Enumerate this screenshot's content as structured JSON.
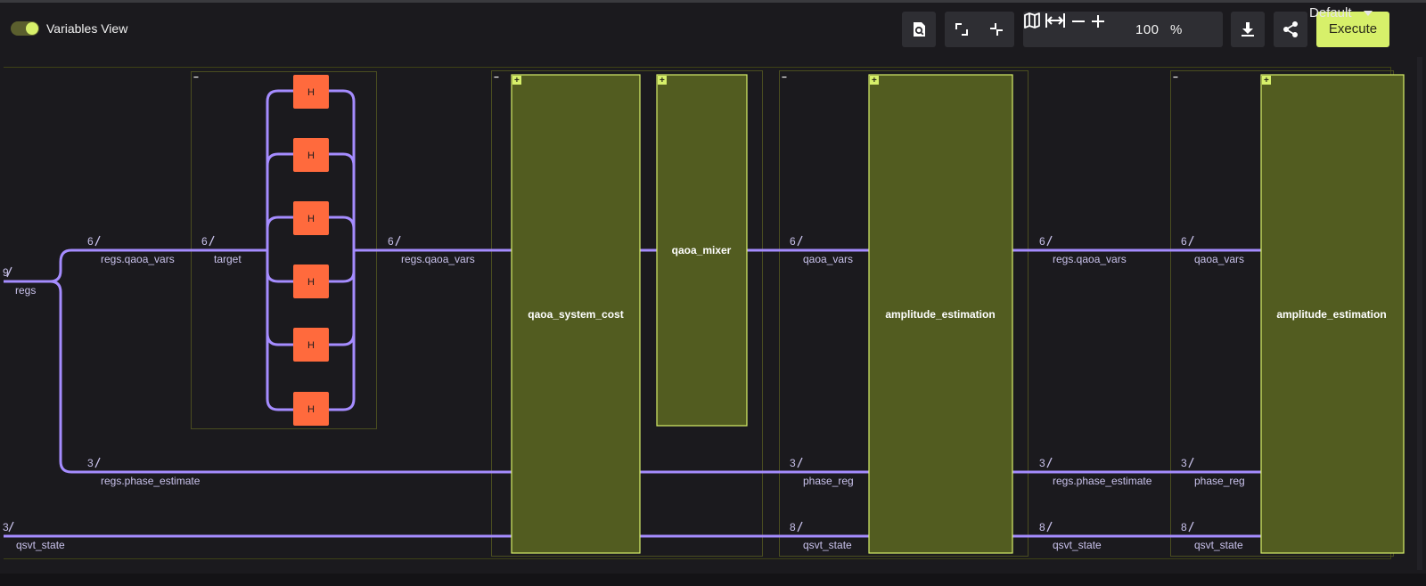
{
  "toolbar": {
    "variables_view_label": "Variables View",
    "variables_view_on": true,
    "zoom_value": "100",
    "zoom_unit": "%",
    "default_label": "Default",
    "execute_label": "Execute",
    "icons": [
      "zoom-fit-icon",
      "expand-icon",
      "collapse-icon",
      "map-icon",
      "fit-width-icon",
      "zoom-out-icon",
      "zoom-in-icon",
      "download-icon",
      "share-icon",
      "dropdown-caret-icon"
    ]
  },
  "colors": {
    "wire": "#a58cff",
    "gate": "#ff6a3d",
    "block_fill": "#525c20",
    "block_border": "#d7f06a",
    "accent": "#d7f06a"
  },
  "circuit": {
    "wire_labels": {
      "regs_count": "9",
      "regs": "regs",
      "qaoa_vars_count": "6",
      "regs_qaoa_vars": "regs.qaoa_vars",
      "target_count": "6",
      "target": "target",
      "regs_qaoa_vars_2_count": "6",
      "regs_qaoa_vars_2": "regs.qaoa_vars",
      "phase_estimate_count": "3",
      "regs_phase_estimate": "regs.phase_estimate",
      "qsvt_state_count": "3",
      "qsvt_state": "qsvt_state",
      "ae1_qaoa_vars_count": "6",
      "ae1_qaoa_vars": "qaoa_vars",
      "ae1_phase_reg_count": "3",
      "ae1_phase_reg": "phase_reg",
      "ae1_qsvt_state_count": "8",
      "ae1_qsvt_state": "qsvt_state",
      "mid_qaoa_vars_count": "6",
      "mid_regs_qaoa_vars": "regs.qaoa_vars",
      "mid_phase_estimate_count": "3",
      "mid_regs_phase_estimate": "regs.phase_estimate",
      "mid_qsvt_state_count": "8",
      "mid_qsvt_state": "qsvt_state",
      "ae2_qaoa_vars_count": "6",
      "ae2_qaoa_vars": "qaoa_vars",
      "ae2_phase_reg_count": "3",
      "ae2_phase_reg": "phase_reg",
      "ae2_qsvt_state_count": "8",
      "ae2_qsvt_state": "qsvt_state"
    },
    "gates": [
      "H",
      "H",
      "H",
      "H",
      "H",
      "H"
    ],
    "blocks": {
      "qaoa_system_cost": "qaoa_system_cost",
      "qaoa_mixer": "qaoa_mixer",
      "amplitude_estimation_1": "amplitude_estimation",
      "amplitude_estimation_2": "amplitude_estimation"
    },
    "expand_glyph": "+",
    "collapse_glyph": "−"
  }
}
